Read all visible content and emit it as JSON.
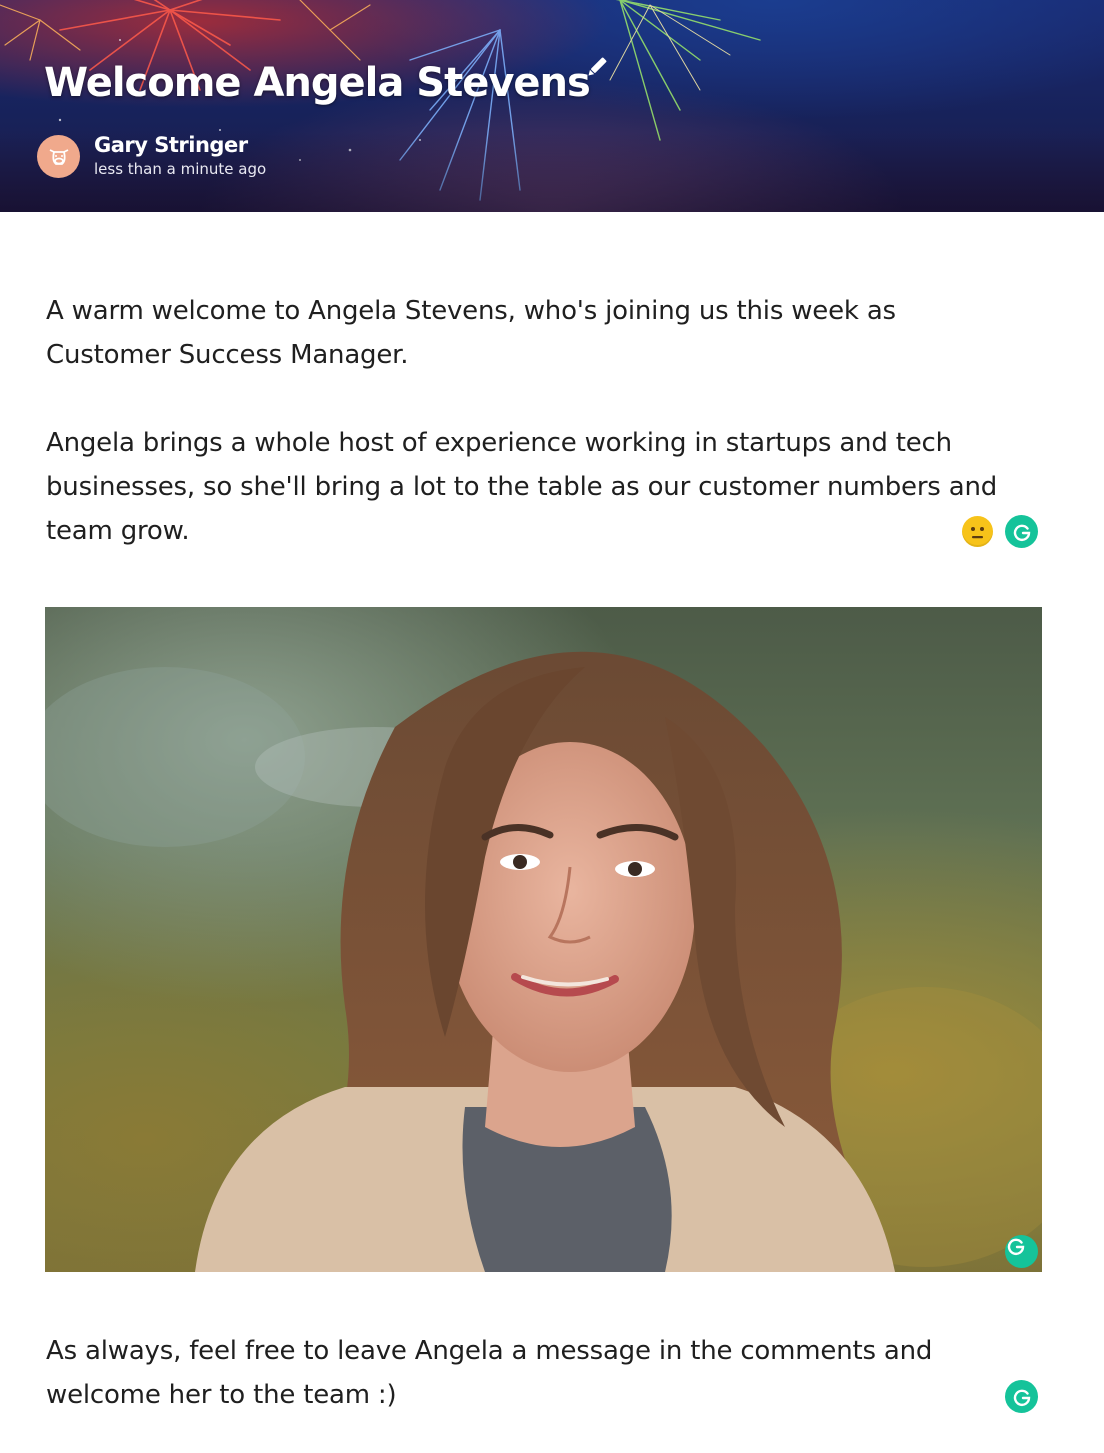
{
  "header": {
    "title": "Welcome Angela Stevens",
    "author_name": "Gary Stringer",
    "timestamp": "less than a minute ago",
    "edit_icon": "pencil-icon",
    "avatar_icon": "cow-face-icon",
    "avatar_color": "#f0a98c"
  },
  "body": {
    "paragraph_1": "A warm welcome to Angela Stevens, who's joining us this week as Customer Success Manager.",
    "paragraph_2": "Angela brings a whole host of experience working in startups and tech businesses, so she'll bring a lot to the table as our customer numbers and team grow.",
    "paragraph_3": "As always, feel free to leave Angela a message in the comments and welcome her to the team :)"
  },
  "widgets": {
    "grammarly_color": "#15c39a",
    "emoji_icon": "neutral-face-emoji-icon"
  }
}
